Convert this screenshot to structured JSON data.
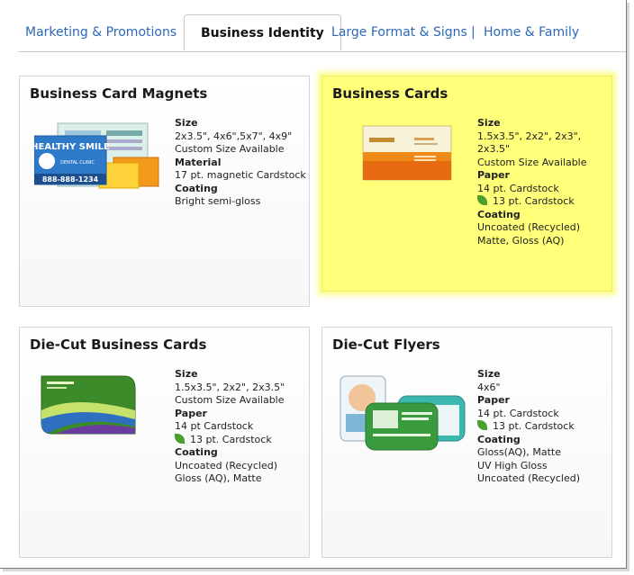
{
  "tabs": [
    {
      "label": "Marketing & Promotions"
    },
    {
      "label": "Business Identity"
    },
    {
      "label": "Large Format & Signs"
    },
    {
      "label": "Home & Family"
    }
  ],
  "tab_separator": "|",
  "products": [
    {
      "title": "Business Card Magnets",
      "image_text": {
        "headline": "HEALTHY SMILE",
        "sub": "DENTAL CLINIC",
        "phone": "888-888-1234"
      },
      "specs": [
        {
          "type": "heading",
          "text": "Size"
        },
        {
          "type": "line",
          "text": "2x3.5\", 4x6\",5x7\", 4x9\""
        },
        {
          "type": "line",
          "text": "Custom Size Available"
        },
        {
          "type": "heading",
          "text": "Material"
        },
        {
          "type": "line",
          "text": "17 pt. magnetic Cardstock"
        },
        {
          "type": "heading",
          "text": "Coating"
        },
        {
          "type": "line",
          "text": "Bright semi-gloss"
        }
      ]
    },
    {
      "title": "Business Cards",
      "specs": [
        {
          "type": "heading",
          "text": "Size"
        },
        {
          "type": "line",
          "text": "1.5x3.5\", 2x2\", 2x3\", 2x3.5\""
        },
        {
          "type": "line",
          "text": "Custom Size Available"
        },
        {
          "type": "heading",
          "text": "Paper"
        },
        {
          "type": "line",
          "text": "14 pt. Cardstock"
        },
        {
          "type": "eco",
          "text": "13 pt. Cardstock"
        },
        {
          "type": "heading",
          "text": "Coating"
        },
        {
          "type": "line",
          "text": "Uncoated (Recycled)"
        },
        {
          "type": "line",
          "text": "Matte, Gloss (AQ)"
        }
      ]
    },
    {
      "title": "Die-Cut Business Cards",
      "specs": [
        {
          "type": "heading",
          "text": "Size"
        },
        {
          "type": "line",
          "text": "1.5x3.5\", 2x2\", 2x3.5\""
        },
        {
          "type": "line",
          "text": "Custom Size Available"
        },
        {
          "type": "heading",
          "text": "Paper"
        },
        {
          "type": "line",
          "text": "14 pt Cardstock"
        },
        {
          "type": "eco",
          "text": "13 pt. Cardstock"
        },
        {
          "type": "heading",
          "text": "Coating"
        },
        {
          "type": "line",
          "text": "Uncoated (Recycled)"
        },
        {
          "type": "line",
          "text": "Gloss (AQ), Matte"
        }
      ]
    },
    {
      "title": "Die-Cut Flyers",
      "specs": [
        {
          "type": "heading",
          "text": "Size"
        },
        {
          "type": "line",
          "text": "4x6\""
        },
        {
          "type": "heading",
          "text": "Paper"
        },
        {
          "type": "line",
          "text": "14 pt. Cardstock"
        },
        {
          "type": "eco",
          "text": "13 pt. Cardstock"
        },
        {
          "type": "heading",
          "text": "Coating"
        },
        {
          "type": "line",
          "text": "Gloss(AQ), Matte"
        },
        {
          "type": "line",
          "text": "UV High Gloss"
        },
        {
          "type": "line",
          "text": "Uncoated (Recycled)"
        }
      ]
    }
  ],
  "colors": {
    "tab_link": "#2d69b8",
    "highlight": "#ffff7a",
    "eco_leaf": "#4aa02c"
  }
}
